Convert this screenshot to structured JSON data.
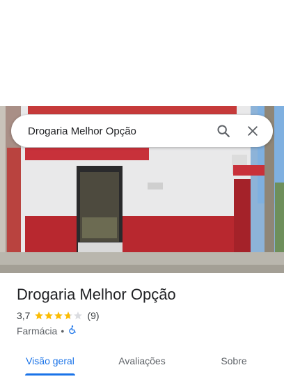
{
  "search": {
    "query": "Drogaria Melhor Opção"
  },
  "icons": {
    "search": "search-icon",
    "close": "close-icon",
    "accessibility": "wheelchair-icon"
  },
  "place": {
    "name": "Drogaria Melhor Opção",
    "rating": "3,7",
    "rating_value": 3.7,
    "reviews": "(9)",
    "category": "Farmácia",
    "separator": "•"
  },
  "tabs": [
    {
      "label": "Visão geral",
      "active": true
    },
    {
      "label": "Avaliações",
      "active": false
    },
    {
      "label": "Sobre",
      "active": false
    }
  ],
  "colors": {
    "accent": "#1a73e8",
    "star": "#fbbc04",
    "star_empty": "#dadce0",
    "storefront_red": "#b22a2e"
  }
}
